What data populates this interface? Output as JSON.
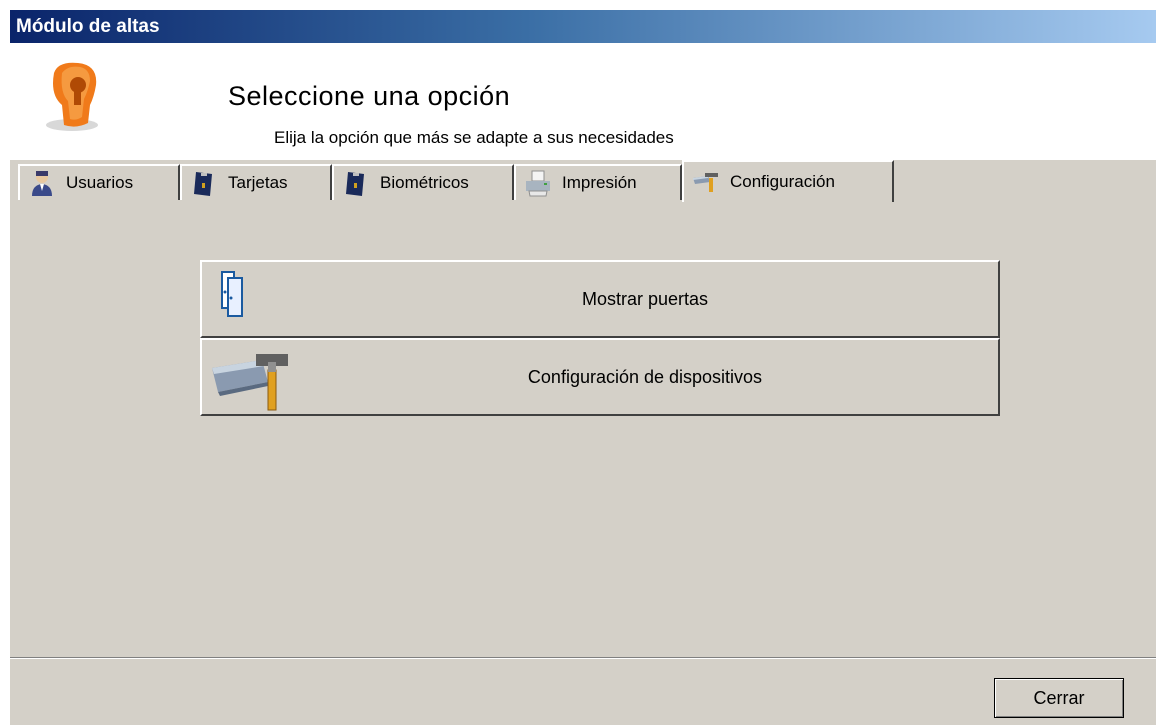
{
  "window": {
    "title": "Módulo de altas"
  },
  "header": {
    "title": "Seleccione una opción",
    "subtitle": "Elija la opción que más se adapte a sus necesidades",
    "logo_icon": "orange-keyhole-logo"
  },
  "tabs": [
    {
      "label": "Usuarios",
      "icon": "user-icon",
      "active": false
    },
    {
      "label": "Tarjetas",
      "icon": "card-icon",
      "active": false
    },
    {
      "label": "Biométricos",
      "icon": "biometric-card-icon",
      "active": false
    },
    {
      "label": "Impresión",
      "icon": "printer-icon",
      "active": false
    },
    {
      "label": "Configuración",
      "icon": "config-tools-icon",
      "active": true
    }
  ],
  "options": [
    {
      "label": "Mostrar puertas",
      "icon": "doors-icon"
    },
    {
      "label": "Configuración de dispositivos",
      "icon": "device-config-icon"
    }
  ],
  "footer": {
    "close_label": "Cerrar"
  },
  "colors": {
    "window_bg": "#d4d0c8",
    "title_start": "#0a246a",
    "title_end": "#a6caf0",
    "logo": "#f07a1a"
  }
}
